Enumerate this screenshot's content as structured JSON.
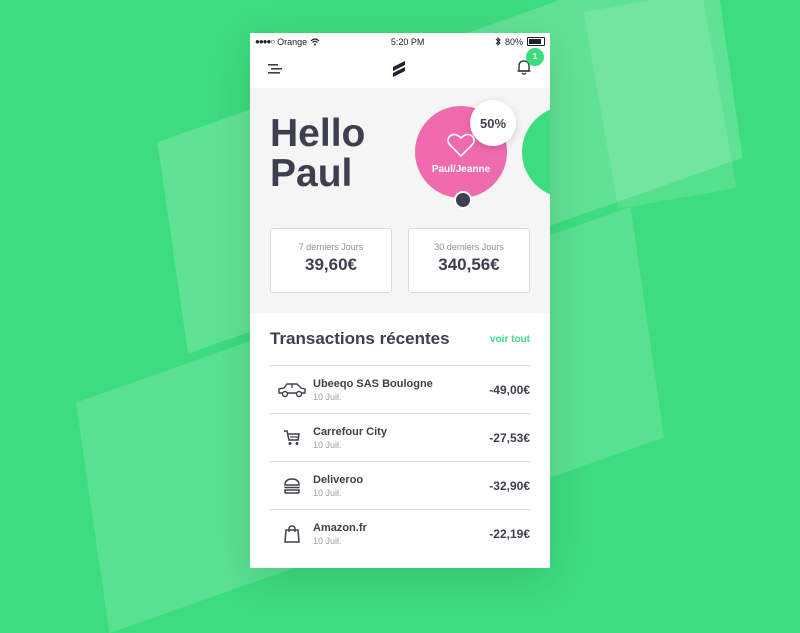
{
  "status": {
    "carrier": "Orange",
    "time": "5:20 PM",
    "battery": "80%"
  },
  "nav": {
    "notifications": "1"
  },
  "hero": {
    "greeting_line1": "Hello",
    "greeting_line2": "Paul",
    "account_label": "Paul/Jeanne",
    "account_percent": "50%"
  },
  "stats": [
    {
      "label": "7 derniers Jours",
      "value": "39,60€"
    },
    {
      "label": "30 derniers Jours",
      "value": "340,56€"
    }
  ],
  "transactions": {
    "title": "Transactions récentes",
    "see_all": "voir tout",
    "items": [
      {
        "name": "Ubeeqo SAS Boulogne",
        "date": "10 Juil.",
        "amount": "-49,00€",
        "icon": "car-icon"
      },
      {
        "name": "Carrefour City",
        "date": "10 Juil.",
        "amount": "-27,53€",
        "icon": "cart-icon"
      },
      {
        "name": "Deliveroo",
        "date": "10 Juil.",
        "amount": "-32,90€",
        "icon": "burger-icon"
      },
      {
        "name": "Amazon.fr",
        "date": "10 Juil.",
        "amount": "-22,19€",
        "icon": "shopping-bag-icon"
      }
    ]
  },
  "colors": {
    "accent": "#3ddc7e",
    "pink": "#f06aae",
    "text": "#3d3f4e"
  }
}
